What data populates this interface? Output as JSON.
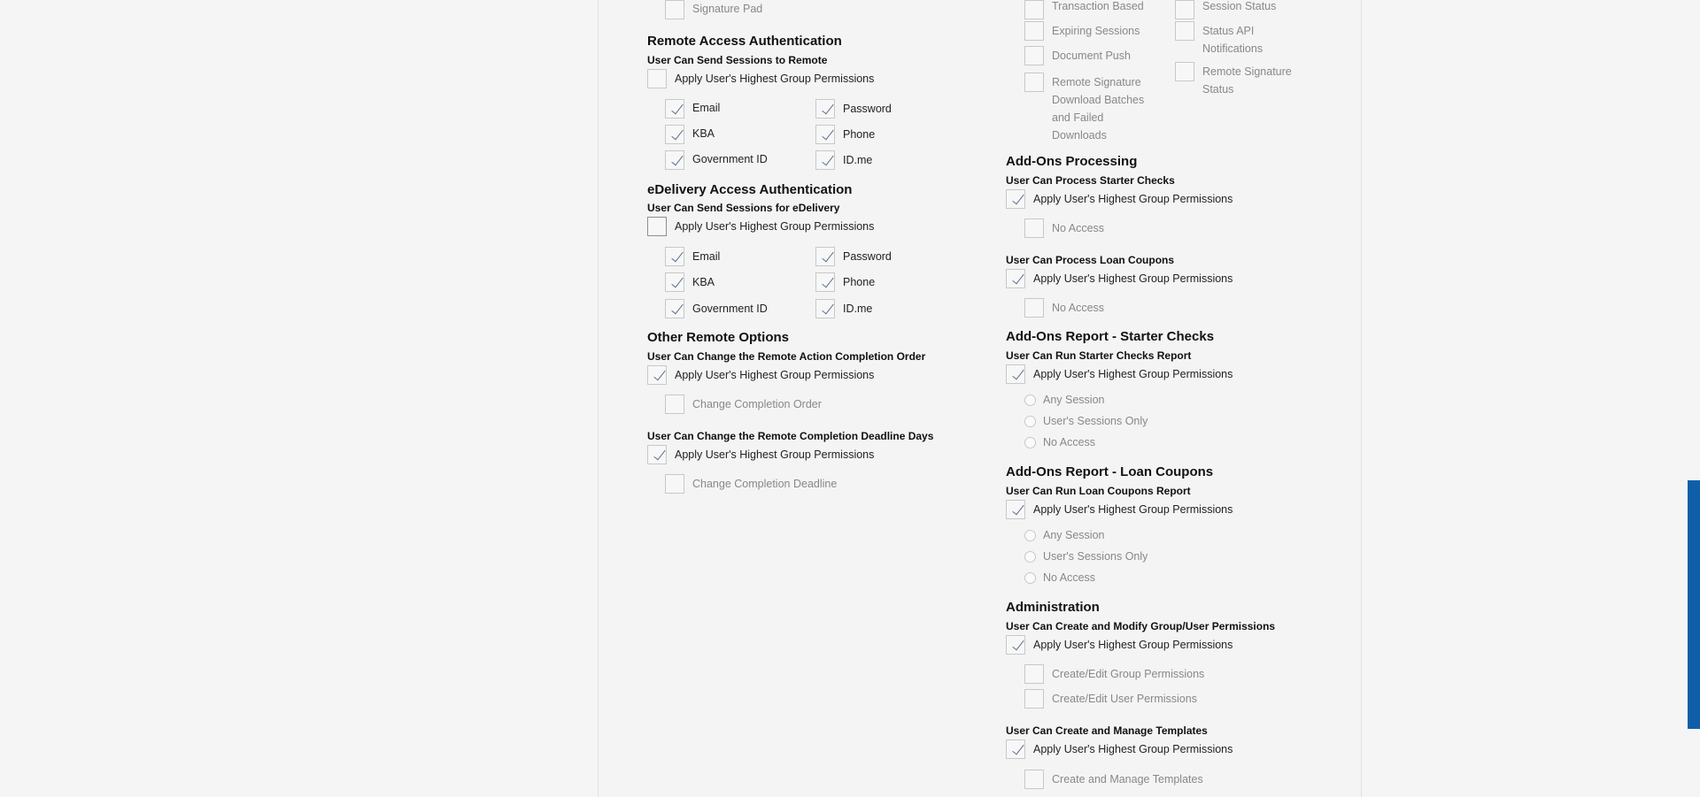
{
  "left": {
    "top_item": "Signature Pad",
    "remote_access": {
      "title": "Remote Access Authentication",
      "subtitle": "User Can Send Sessions to Remote",
      "apply": "Apply User's Highest Group Permissions",
      "options": [
        "Email",
        "Password",
        "KBA",
        "Phone",
        "Government ID",
        "ID.me"
      ]
    },
    "edelivery_access": {
      "title": "eDelivery Access Authentication",
      "subtitle": "User Can Send Sessions for eDelivery",
      "apply": "Apply User's Highest Group Permissions",
      "options": [
        "Email",
        "Password",
        "KBA",
        "Phone",
        "Government ID",
        "ID.me"
      ]
    },
    "other_remote": {
      "title": "Other Remote Options",
      "completion_order": {
        "subtitle": "User Can Change the Remote Action Completion Order",
        "apply": "Apply User's Highest Group Permissions",
        "option": "Change Completion Order"
      },
      "deadline_days": {
        "subtitle": "User Can Change the Remote Completion Deadline Days",
        "apply": "Apply User's Highest Group Permissions",
        "option": "Change Completion Deadline"
      }
    }
  },
  "right": {
    "top_col1": [
      "Transaction Based",
      "Expiring Sessions",
      "Document Push",
      "Remote Signature",
      "Download Batches",
      "and Failed",
      "Downloads"
    ],
    "top_col2": [
      "Session Status",
      "Status API",
      "Notifications",
      "Remote Signature",
      "Status"
    ],
    "addons_processing": {
      "title": "Add-Ons Processing",
      "starter_checks": {
        "subtitle": "User Can Process Starter Checks",
        "apply": "Apply User's Highest Group Permissions",
        "option": "No Access"
      },
      "loan_coupons": {
        "subtitle": "User Can Process Loan Coupons",
        "apply": "Apply User's Highest Group Permissions",
        "option": "No Access"
      }
    },
    "report_starter": {
      "title": "Add-Ons Report - Starter Checks",
      "subtitle": "User Can Run Starter Checks Report",
      "apply": "Apply User's Highest Group Permissions",
      "radios": [
        "Any Session",
        "User's Sessions Only",
        "No Access"
      ]
    },
    "report_loan": {
      "title": "Add-Ons Report - Loan Coupons",
      "subtitle": "User Can Run Loan Coupons Report",
      "apply": "Apply User's Highest Group Permissions",
      "radios": [
        "Any Session",
        "User's Sessions Only",
        "No Access"
      ]
    },
    "administration": {
      "title": "Administration",
      "permissions": {
        "subtitle": "User Can Create and Modify Group/User Permissions",
        "apply": "Apply User's Highest Group Permissions",
        "options": [
          "Create/Edit Group Permissions",
          "Create/Edit User Permissions"
        ]
      },
      "templates": {
        "subtitle": "User Can Create and Manage Templates",
        "apply": "Apply User's Highest Group Permissions",
        "option": "Create and Manage Templates"
      }
    }
  }
}
